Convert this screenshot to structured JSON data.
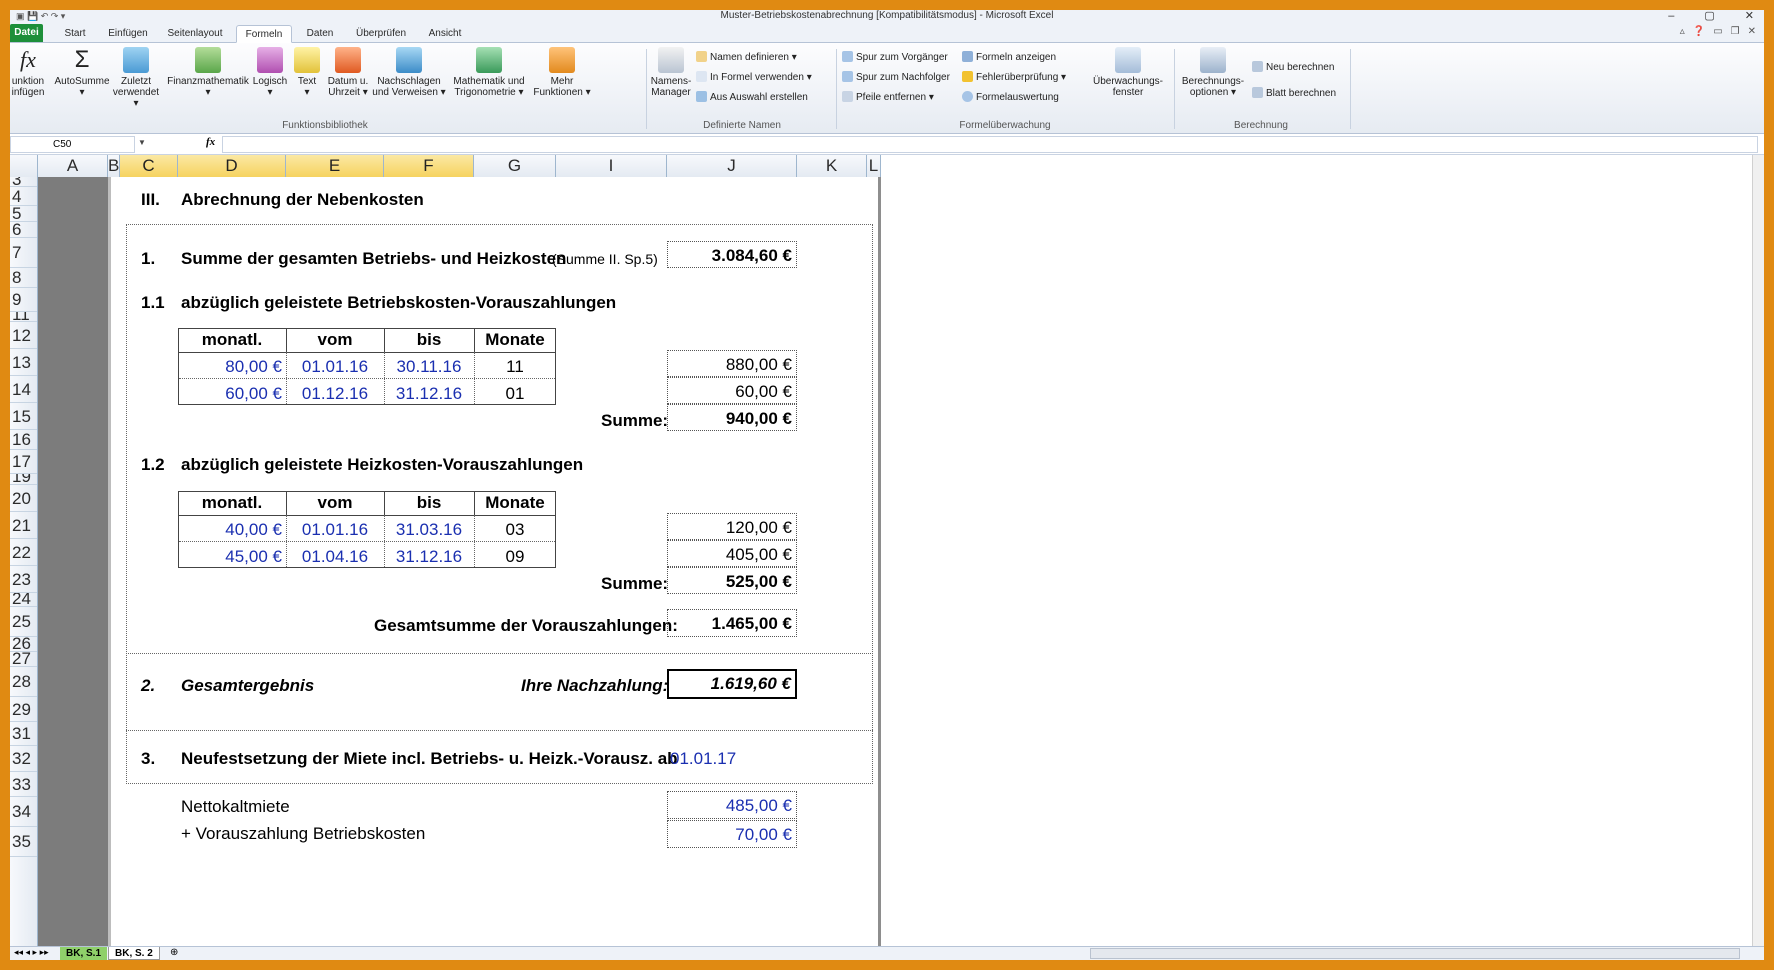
{
  "window": {
    "title": "Muster-Betriebskostenabrechnung [Kompatibilitätsmodus] - Microsoft Excel",
    "minimize": "–",
    "restore": "▢",
    "close": "✕"
  },
  "tabs": [
    "Datei",
    "Start",
    "Einfügen",
    "Seitenlayout",
    "Formeln",
    "Daten",
    "Überprüfen",
    "Ansicht"
  ],
  "ribbon": {
    "funktion": [
      "unktion",
      "infügen"
    ],
    "autosumme": [
      "AutoSumme",
      ""
    ],
    "zuletzt": [
      "Zuletzt",
      "verwendet"
    ],
    "finanz": [
      "Finanzmathematik",
      ""
    ],
    "logisch": [
      "Logisch",
      ""
    ],
    "text": [
      "Text",
      ""
    ],
    "datum": [
      "Datum u.",
      "Uhrzeit"
    ],
    "nachschlagen": [
      "Nachschlagen",
      "und Verweisen"
    ],
    "mathematik": [
      "Mathematik und",
      "Trigonometrie"
    ],
    "mehr": [
      "Mehr",
      "Funktionen"
    ],
    "namensmanager": [
      "Namens-",
      "Manager"
    ],
    "namen_definieren": "Namen definieren",
    "in_formel": "In Formel verwenden",
    "aus_auswahl": "Aus Auswahl erstellen",
    "spur_vorgaenger": "Spur zum Vorgänger",
    "spur_nachfolger": "Spur zum Nachfolger",
    "pfeile": "Pfeile entfernen",
    "formeln_anzeigen": "Formeln anzeigen",
    "fehlerueberpruefung": "Fehlerüberprüfung",
    "formelauswertung": "Formelauswertung",
    "ueberwachung": [
      "Überwachungs-",
      "fenster"
    ],
    "berechnungsoptionen": [
      "Berechnungs-",
      "optionen"
    ],
    "neu_berechnen": "Neu berechnen",
    "blatt_berechnen": "Blatt berechnen",
    "groups": [
      "Funktionsbibliothek",
      "Definierte Namen",
      "Formelüberwachung",
      "Berechnung"
    ]
  },
  "formula_bar": {
    "name_box": "C50",
    "fx": "fx",
    "content": ""
  },
  "columns": [
    "A",
    "B",
    "C",
    "D",
    "E",
    "F",
    "G",
    "I",
    "J",
    "K",
    "L"
  ],
  "rows": [
    "3",
    "4",
    "5",
    "6",
    "7",
    "8",
    "9",
    "11",
    "12",
    "13",
    "14",
    "15",
    "16",
    "17",
    "19",
    "20",
    "21",
    "22",
    "23",
    "24",
    "25",
    "26",
    "27",
    "28",
    "29",
    "31",
    "32",
    "33",
    "34",
    "35"
  ],
  "sheet": {
    "section": {
      "num": "III.",
      "title": "Abrechnung der Nebenkosten"
    },
    "s1": {
      "num": "1.",
      "title": "Summe der gesamten Betriebs- und Heizkosten",
      "note": "(Summe II. Sp.5)",
      "value": "3.084,60 €"
    },
    "s11": {
      "num": "1.1",
      "title": "abzüglich geleistete Betriebskosten-Vorauszahlungen"
    },
    "table_headers": [
      "monatl.",
      "vom",
      "bis",
      "Monate"
    ],
    "t1_rows": [
      [
        "80,00 €",
        "01.01.16",
        "30.11.16",
        "11",
        "880,00 €"
      ],
      [
        "60,00 €",
        "01.12.16",
        "31.12.16",
        "01",
        "60,00 €"
      ]
    ],
    "sum_label": "Summe:",
    "t1_sum": "940,00 €",
    "s12": {
      "num": "1.2",
      "title": "abzüglich geleistete Heizkosten-Vorauszahlungen"
    },
    "t2_rows": [
      [
        "40,00 €",
        "01.01.16",
        "31.03.16",
        "03",
        "120,00 €"
      ],
      [
        "45,00 €",
        "01.04.16",
        "31.12.16",
        "09",
        "405,00 €"
      ]
    ],
    "t2_sum": "525,00 €",
    "total_label": "Gesamtsumme der Vorauszahlungen:",
    "total_value": "1.465,00 €",
    "s2": {
      "num": "2.",
      "title": "Gesamtergebnis",
      "label": "Ihre Nachzahlung:",
      "value": "1.619,60 €"
    },
    "s3": {
      "num": "3.",
      "title": "Neufestsetzung der Miete incl. Betriebs- u. Heizk.-Vorausz. ab",
      "date": "01.01.17"
    },
    "netto": {
      "label": "Nettokaltmiete",
      "value": "485,00 €"
    },
    "vz_betrieb": {
      "label": "+ Vorauszahlung Betriebskosten",
      "value": "70,00 €"
    }
  },
  "sheet_tabs": [
    "BK, S.1",
    "BK, S. 2"
  ],
  "colors": {
    "file_tab": "#1d8f3a",
    "selected_col": "#f6d35f",
    "accent_blue": "#1a2fb0",
    "frame": "#e08a12"
  }
}
